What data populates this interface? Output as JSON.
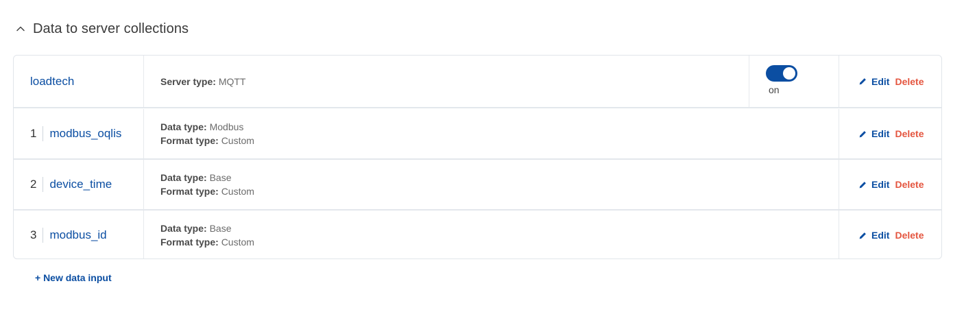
{
  "section": {
    "title": "Data to server collections",
    "icon": "chevron-up-icon"
  },
  "collection": {
    "name": "loadtech",
    "server_type_label": "Server type:",
    "server_type_value": "MQTT",
    "toggle_state": "on",
    "edit_label": "Edit",
    "delete_label": "Delete"
  },
  "inputs": [
    {
      "index": "1",
      "name": "modbus_oqlis",
      "data_type_label": "Data type:",
      "data_type_value": "Modbus",
      "format_type_label": "Format type:",
      "format_type_value": "Custom",
      "edit_label": "Edit",
      "delete_label": "Delete"
    },
    {
      "index": "2",
      "name": "device_time",
      "data_type_label": "Data type:",
      "data_type_value": "Base",
      "format_type_label": "Format type:",
      "format_type_value": "Custom",
      "edit_label": "Edit",
      "delete_label": "Delete"
    },
    {
      "index": "3",
      "name": "modbus_id",
      "data_type_label": "Data type:",
      "data_type_value": "Base",
      "format_type_label": "Format type:",
      "format_type_value": "Custom",
      "edit_label": "Edit",
      "delete_label": "Delete"
    }
  ],
  "new_input_label": "+ New data input",
  "colors": {
    "accent": "#0b4ea2",
    "danger": "#e4553f",
    "border": "#e1e5ea"
  }
}
